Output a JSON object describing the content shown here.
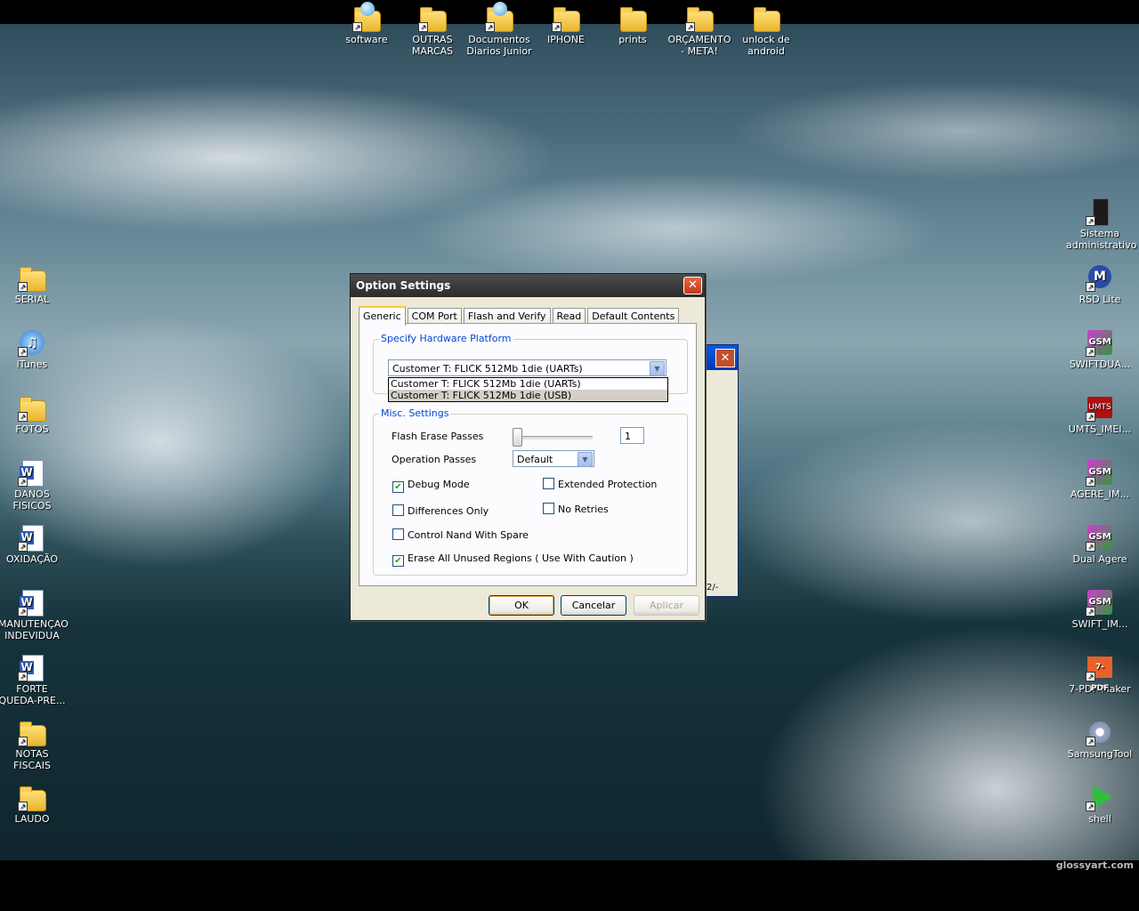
{
  "desktop": {
    "top_icons": [
      {
        "label": "software",
        "icon": "globe-folder-icon"
      },
      {
        "label": "OUTRAS MARCAS",
        "icon": "folder-icon"
      },
      {
        "label": "Documentos Diarios Junior",
        "icon": "globe-folder-icon"
      },
      {
        "label": "IPHONE",
        "icon": "folder-icon"
      },
      {
        "label": "prints",
        "icon": "folder-icon"
      },
      {
        "label": "ORÇAMENTO - META!",
        "icon": "folder-icon"
      },
      {
        "label": "unlock de android",
        "icon": "folder-icon"
      }
    ],
    "left_icons": [
      {
        "label": "SERIAL",
        "icon": "folder-icon"
      },
      {
        "label": "iTunes",
        "icon": "itunes-icon"
      },
      {
        "label": "FOTOS",
        "icon": "folder-icon"
      },
      {
        "label": "DANOS FISICOS",
        "icon": "word-doc-icon"
      },
      {
        "label": "OXIDAÇÃO",
        "icon": "word-doc-icon"
      },
      {
        "label": "MANUTENÇAO INDEVIDUA",
        "icon": "word-doc-icon"
      },
      {
        "label": "FORTE QUEDA-PRE...",
        "icon": "word-doc-icon"
      },
      {
        "label": "NOTAS FISCAIS",
        "icon": "folder-icon"
      },
      {
        "label": "LAUDO",
        "icon": "folder-icon"
      }
    ],
    "right_icons": [
      {
        "label": "Sistema administrativo",
        "icon": "computer-icon"
      },
      {
        "label": "RSD Lite",
        "icon": "motorola-icon"
      },
      {
        "label": "SWIFTDUA...",
        "icon": "gsm-icon"
      },
      {
        "label": "UMTS_IMEI...",
        "icon": "umts-icon"
      },
      {
        "label": "AGERE_IM...",
        "icon": "gsm-icon"
      },
      {
        "label": "Dual Agere",
        "icon": "gsm-icon"
      },
      {
        "label": "SWIFT_IM...",
        "icon": "gsm-icon"
      },
      {
        "label": "7-PDF Maker",
        "icon": "pdf-icon"
      },
      {
        "label": "SamsungTool",
        "icon": "gear-icon"
      },
      {
        "label": "shell",
        "icon": "play-icon"
      }
    ],
    "watermark": "glossyart.com",
    "gsm_text": "GSM",
    "umts_text": "UMTS",
    "pdf_text": "7-PDF",
    "moto_text": "M",
    "itunes_text": "♫",
    "word_text": "W"
  },
  "bg_window": {
    "close": "✕",
    "fragment": "2/-"
  },
  "dialog": {
    "title": "Option Settings",
    "close": "✕",
    "tabs": [
      "Generic",
      "COM Port",
      "Flash and Verify",
      "Read",
      "Default Contents"
    ],
    "hardware": {
      "legend": "Specify Hardware Platform",
      "selected": "Customer T: FLICK 512Mb 1die (UARTs)",
      "options": [
        "Customer T: FLICK 512Mb 1die (UARTs)",
        "Customer T: FLICK 512Mb 1die (USB)"
      ],
      "highlighted_index": 1
    },
    "misc": {
      "legend": "Misc. Settings",
      "flash_erase_label": "Flash Erase Passes",
      "flash_erase_value": "1",
      "operation_label": "Operation Passes",
      "operation_value": "Default",
      "checkboxes": [
        {
          "label": "Debug Mode",
          "checked": true
        },
        {
          "label": "Extended Protection",
          "checked": false
        },
        {
          "label": "Differences Only",
          "checked": false
        },
        {
          "label": "No Retries",
          "checked": false
        },
        {
          "label": "Control Nand With Spare",
          "checked": false
        },
        {
          "label": "Erase All Unused Regions ( Use With Caution )",
          "checked": true
        }
      ]
    },
    "buttons": {
      "ok": "OK",
      "cancel": "Cancelar",
      "apply": "Aplicar"
    }
  }
}
